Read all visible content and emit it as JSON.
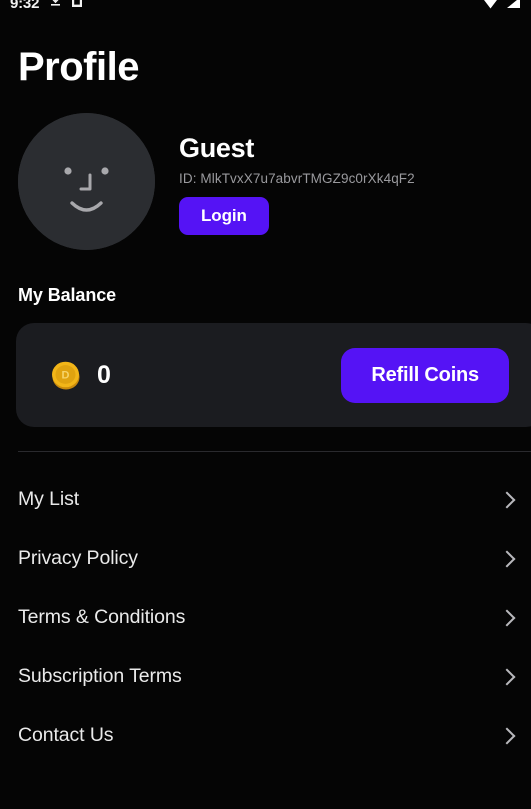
{
  "statusbar": {
    "clock": "9:32",
    "left_icons": [
      "download-icon",
      "sim-card-icon"
    ],
    "right_icons": [
      "wifi-icon",
      "signal-icon"
    ]
  },
  "header": {
    "title": "Profile"
  },
  "profile": {
    "avatar_icon": "guest-avatar-smiley",
    "name": "Guest",
    "id": "ID: MlkTvxX7u7abvrTMGZ9c0rXk4qF2",
    "login_label": "Login"
  },
  "balance": {
    "section_label": "My Balance",
    "coin_icon": "gold-coin-icon",
    "coin_letter": "D",
    "amount": "0",
    "refill_label": "Refill Coins"
  },
  "menu": {
    "items": [
      {
        "label": "My List",
        "chevron": "chevron-right-icon"
      },
      {
        "label": "Privacy Policy",
        "chevron": "chevron-right-icon"
      },
      {
        "label": "Terms & Conditions",
        "chevron": "chevron-right-icon"
      },
      {
        "label": "Subscription Terms",
        "chevron": "chevron-right-icon"
      },
      {
        "label": "Contact Us",
        "chevron": "chevron-right-icon"
      }
    ]
  },
  "colors": {
    "background": "#050505",
    "accent_purple": "#5513f5",
    "card_background": "#1b1c20",
    "avatar_background": "#2b2d31",
    "coin_gold": "#f2b518",
    "muted_text": "#9a9a9e"
  }
}
